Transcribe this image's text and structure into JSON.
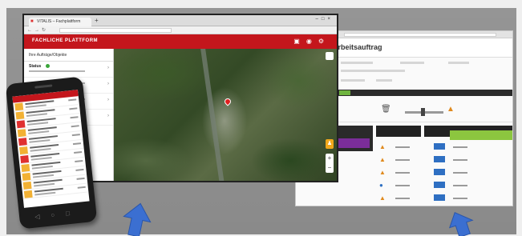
{
  "map_window": {
    "tab_title": "VITALIS – Fachplattform",
    "app_title": "FACHLICHE PLATTFORM",
    "sidebar": {
      "header": "Ihre Aufträge/Objekte",
      "items": [
        {
          "label": "Status"
        },
        {
          "label": ""
        },
        {
          "label": ""
        },
        {
          "label": ""
        }
      ]
    }
  },
  "right_window": {
    "title": "Arbeitsauftrag"
  },
  "phone": {
    "row_colors": [
      "#f2b134",
      "#f2b134",
      "#e03030",
      "#f2b134",
      "#e03030",
      "#f2b134",
      "#e03030",
      "#f2b134",
      "#f2b134",
      "#f2b134",
      "#f2b134"
    ]
  },
  "colors": {
    "accent_red": "#c4161c",
    "arrow_blue": "#3b6fd1",
    "status_green": "#3aa53a"
  }
}
